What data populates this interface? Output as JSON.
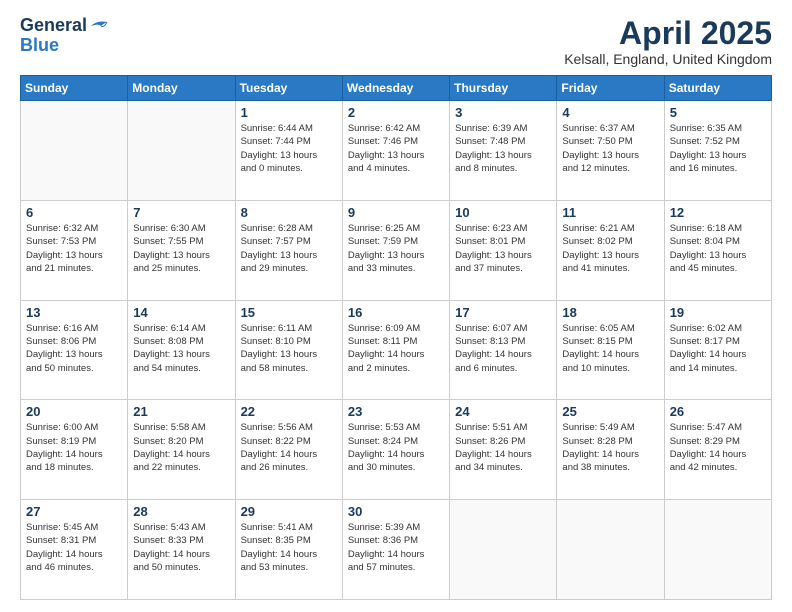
{
  "header": {
    "logo_general": "General",
    "logo_blue": "Blue",
    "month_title": "April 2025",
    "location": "Kelsall, England, United Kingdom"
  },
  "weekdays": [
    "Sunday",
    "Monday",
    "Tuesday",
    "Wednesday",
    "Thursday",
    "Friday",
    "Saturday"
  ],
  "weeks": [
    [
      {
        "day": "",
        "details": ""
      },
      {
        "day": "",
        "details": ""
      },
      {
        "day": "1",
        "details": "Sunrise: 6:44 AM\nSunset: 7:44 PM\nDaylight: 13 hours\nand 0 minutes."
      },
      {
        "day": "2",
        "details": "Sunrise: 6:42 AM\nSunset: 7:46 PM\nDaylight: 13 hours\nand 4 minutes."
      },
      {
        "day": "3",
        "details": "Sunrise: 6:39 AM\nSunset: 7:48 PM\nDaylight: 13 hours\nand 8 minutes."
      },
      {
        "day": "4",
        "details": "Sunrise: 6:37 AM\nSunset: 7:50 PM\nDaylight: 13 hours\nand 12 minutes."
      },
      {
        "day": "5",
        "details": "Sunrise: 6:35 AM\nSunset: 7:52 PM\nDaylight: 13 hours\nand 16 minutes."
      }
    ],
    [
      {
        "day": "6",
        "details": "Sunrise: 6:32 AM\nSunset: 7:53 PM\nDaylight: 13 hours\nand 21 minutes."
      },
      {
        "day": "7",
        "details": "Sunrise: 6:30 AM\nSunset: 7:55 PM\nDaylight: 13 hours\nand 25 minutes."
      },
      {
        "day": "8",
        "details": "Sunrise: 6:28 AM\nSunset: 7:57 PM\nDaylight: 13 hours\nand 29 minutes."
      },
      {
        "day": "9",
        "details": "Sunrise: 6:25 AM\nSunset: 7:59 PM\nDaylight: 13 hours\nand 33 minutes."
      },
      {
        "day": "10",
        "details": "Sunrise: 6:23 AM\nSunset: 8:01 PM\nDaylight: 13 hours\nand 37 minutes."
      },
      {
        "day": "11",
        "details": "Sunrise: 6:21 AM\nSunset: 8:02 PM\nDaylight: 13 hours\nand 41 minutes."
      },
      {
        "day": "12",
        "details": "Sunrise: 6:18 AM\nSunset: 8:04 PM\nDaylight: 13 hours\nand 45 minutes."
      }
    ],
    [
      {
        "day": "13",
        "details": "Sunrise: 6:16 AM\nSunset: 8:06 PM\nDaylight: 13 hours\nand 50 minutes."
      },
      {
        "day": "14",
        "details": "Sunrise: 6:14 AM\nSunset: 8:08 PM\nDaylight: 13 hours\nand 54 minutes."
      },
      {
        "day": "15",
        "details": "Sunrise: 6:11 AM\nSunset: 8:10 PM\nDaylight: 13 hours\nand 58 minutes."
      },
      {
        "day": "16",
        "details": "Sunrise: 6:09 AM\nSunset: 8:11 PM\nDaylight: 14 hours\nand 2 minutes."
      },
      {
        "day": "17",
        "details": "Sunrise: 6:07 AM\nSunset: 8:13 PM\nDaylight: 14 hours\nand 6 minutes."
      },
      {
        "day": "18",
        "details": "Sunrise: 6:05 AM\nSunset: 8:15 PM\nDaylight: 14 hours\nand 10 minutes."
      },
      {
        "day": "19",
        "details": "Sunrise: 6:02 AM\nSunset: 8:17 PM\nDaylight: 14 hours\nand 14 minutes."
      }
    ],
    [
      {
        "day": "20",
        "details": "Sunrise: 6:00 AM\nSunset: 8:19 PM\nDaylight: 14 hours\nand 18 minutes."
      },
      {
        "day": "21",
        "details": "Sunrise: 5:58 AM\nSunset: 8:20 PM\nDaylight: 14 hours\nand 22 minutes."
      },
      {
        "day": "22",
        "details": "Sunrise: 5:56 AM\nSunset: 8:22 PM\nDaylight: 14 hours\nand 26 minutes."
      },
      {
        "day": "23",
        "details": "Sunrise: 5:53 AM\nSunset: 8:24 PM\nDaylight: 14 hours\nand 30 minutes."
      },
      {
        "day": "24",
        "details": "Sunrise: 5:51 AM\nSunset: 8:26 PM\nDaylight: 14 hours\nand 34 minutes."
      },
      {
        "day": "25",
        "details": "Sunrise: 5:49 AM\nSunset: 8:28 PM\nDaylight: 14 hours\nand 38 minutes."
      },
      {
        "day": "26",
        "details": "Sunrise: 5:47 AM\nSunset: 8:29 PM\nDaylight: 14 hours\nand 42 minutes."
      }
    ],
    [
      {
        "day": "27",
        "details": "Sunrise: 5:45 AM\nSunset: 8:31 PM\nDaylight: 14 hours\nand 46 minutes."
      },
      {
        "day": "28",
        "details": "Sunrise: 5:43 AM\nSunset: 8:33 PM\nDaylight: 14 hours\nand 50 minutes."
      },
      {
        "day": "29",
        "details": "Sunrise: 5:41 AM\nSunset: 8:35 PM\nDaylight: 14 hours\nand 53 minutes."
      },
      {
        "day": "30",
        "details": "Sunrise: 5:39 AM\nSunset: 8:36 PM\nDaylight: 14 hours\nand 57 minutes."
      },
      {
        "day": "",
        "details": ""
      },
      {
        "day": "",
        "details": ""
      },
      {
        "day": "",
        "details": ""
      }
    ]
  ]
}
